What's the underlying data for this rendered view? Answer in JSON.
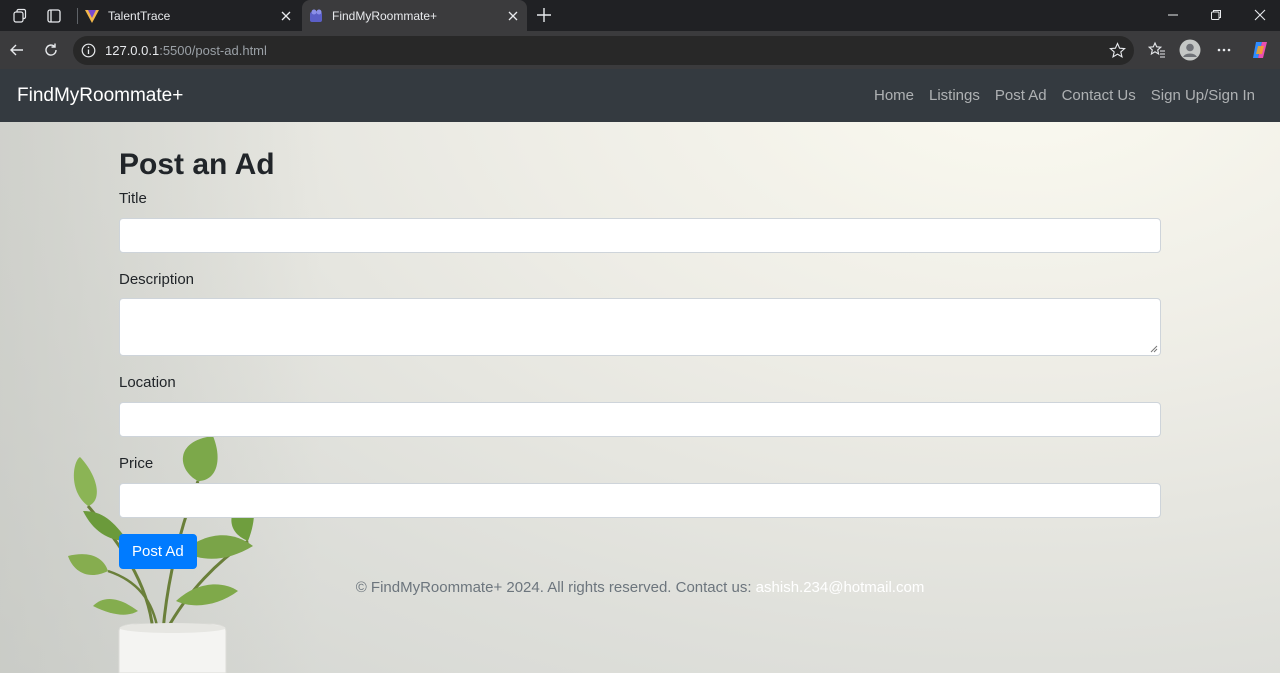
{
  "browser": {
    "tabs": [
      {
        "title": "TalentTrace",
        "active": false
      },
      {
        "title": "FindMyRoommate+",
        "active": true
      }
    ],
    "url_host": "127.0.0.1",
    "url_rest": ":5500/post-ad.html"
  },
  "colors": {
    "navbar_bg": "#343a40",
    "primary": "#007bff",
    "chrome_bg": "#202124",
    "toolbar_bg": "#3b3b3d"
  },
  "site": {
    "brand": "FindMyRoommate+",
    "nav": [
      "Home",
      "Listings",
      "Post Ad",
      "Contact Us",
      "Sign Up/Sign In"
    ]
  },
  "form": {
    "heading": "Post an Ad",
    "fields": [
      {
        "label": "Title",
        "value": ""
      },
      {
        "label": "Description",
        "value": ""
      },
      {
        "label": "Location",
        "value": ""
      },
      {
        "label": "Price",
        "value": ""
      }
    ],
    "submit": "Post Ad"
  },
  "footer": {
    "text": "© FindMyRoommate+ 2024. All rights reserved. Contact us: ",
    "email": "ashish.234@hotmail.com"
  },
  "icons": [
    "workspaces-icon",
    "tab-actions-icon",
    "talenttrace-favicon",
    "findmyroommate-favicon",
    "close-icon",
    "new-tab-icon",
    "minimize-icon",
    "restore-icon",
    "window-close-icon",
    "back-icon",
    "reload-icon",
    "site-info-icon",
    "favorite-star-icon",
    "favorites-icon",
    "profile-icon",
    "more-icon",
    "copilot-icon"
  ]
}
